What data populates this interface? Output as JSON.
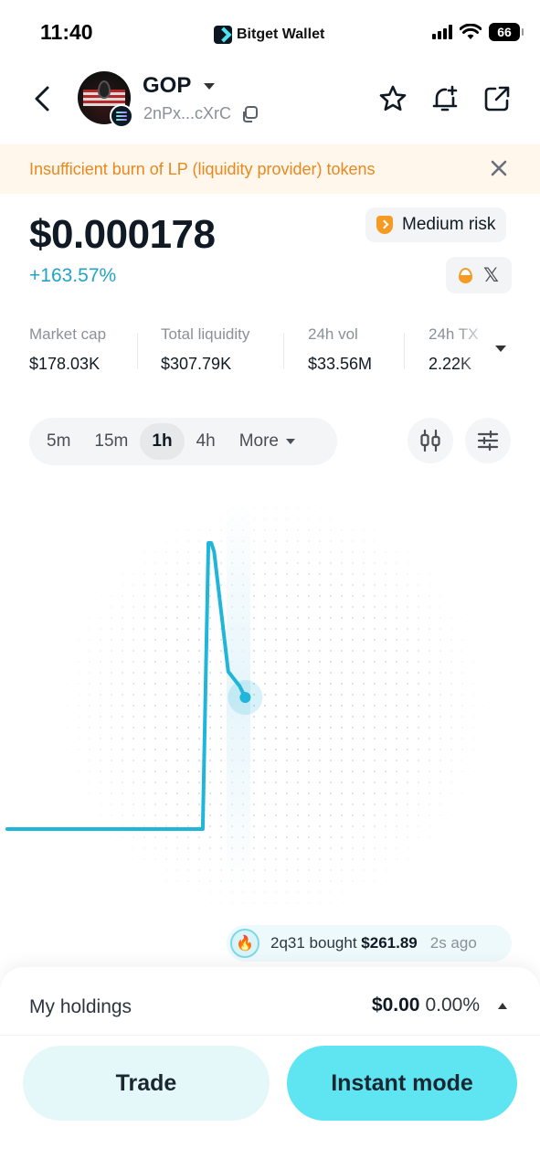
{
  "status_bar": {
    "time": "11:40",
    "app_brand": "Bitget Wallet",
    "battery": "66"
  },
  "header": {
    "token_symbol": "GOP",
    "token_address": "2nPx...cXrC",
    "icons": [
      "back-icon",
      "copy-icon",
      "star-icon",
      "bell-plus-icon",
      "share-icon"
    ]
  },
  "warning": {
    "text": "Insufficient burn of LP (liquidity provider) tokens"
  },
  "price": {
    "value": "$0.000178",
    "change": "+163.57%",
    "risk_label": "Medium risk",
    "risk_color": "#f59a23",
    "change_color": "#22a3c8"
  },
  "stats": [
    {
      "label": "Market cap",
      "value": "$178.03K"
    },
    {
      "label": "Total liquidity",
      "value": "$307.79K"
    },
    {
      "label": "24h vol",
      "value": "$33.56M"
    },
    {
      "label": "24h TX",
      "value": "2.22K"
    }
  ],
  "timeframes": {
    "tabs": [
      "5m",
      "15m",
      "1h",
      "4h",
      "More"
    ],
    "active": "1h"
  },
  "chart_data": {
    "type": "line",
    "title": "",
    "xlabel": "",
    "ylabel": "",
    "line_color": "#1fb6d9",
    "points": [
      [
        0,
        0.0
      ],
      [
        0.69,
        0.0
      ],
      [
        0.71,
        1.0
      ],
      [
        0.72,
        1.0
      ],
      [
        0.73,
        0.97
      ],
      [
        0.78,
        0.55
      ],
      [
        0.82,
        0.5
      ],
      [
        0.84,
        0.46
      ]
    ],
    "grid": "dotted"
  },
  "activity": {
    "prefix": "2q31 bought",
    "amount": "$261.89",
    "time": "2s ago"
  },
  "holdings": {
    "label": "My holdings",
    "value": "$0.00",
    "percent": "0.00%"
  },
  "actions": {
    "trade": "Trade",
    "instant": "Instant mode"
  }
}
